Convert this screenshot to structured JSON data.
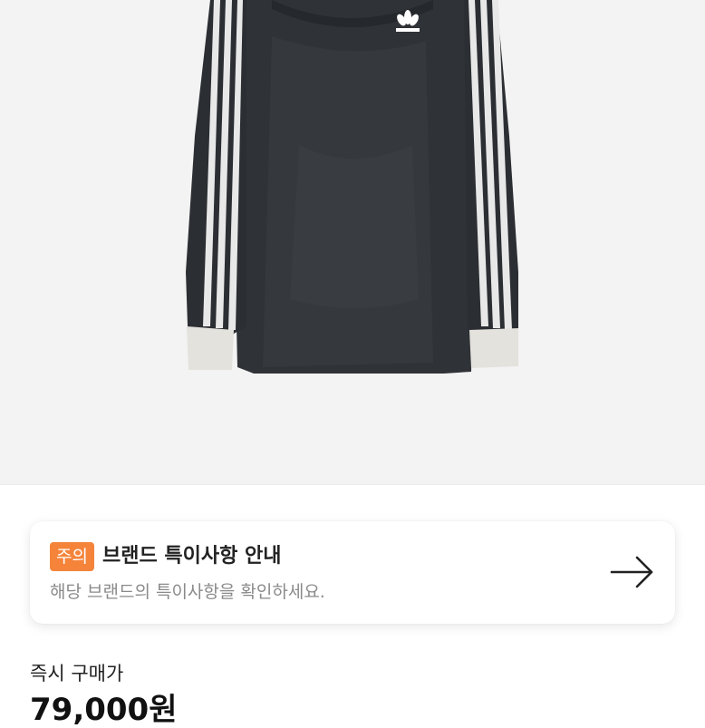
{
  "product": {
    "image_alt_icon": "track-jersey-long-sleeve-black-product-image",
    "background_color": "#f3f3f3"
  },
  "notice": {
    "badge": "주의",
    "badge_color": "#f5843a",
    "title": "브랜드 특이사항 안내",
    "description": "해당 브랜드의 특이사항을 확인하세요.",
    "action_icon": "arrow-right-icon"
  },
  "price": {
    "label": "즉시 구매가",
    "value": "79,000원"
  }
}
